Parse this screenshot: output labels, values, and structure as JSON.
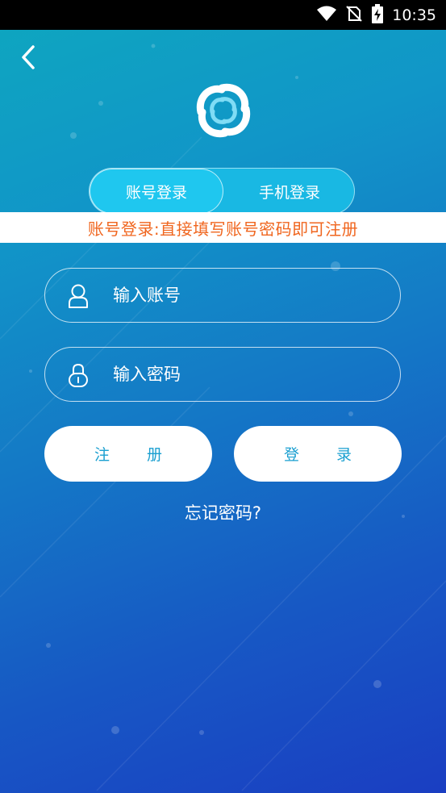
{
  "status_bar": {
    "time": "10:35",
    "icons": [
      "wifi-icon",
      "no-sim-icon",
      "battery-charging-icon"
    ]
  },
  "nav": {
    "back_icon": "chevron-left-icon"
  },
  "tabs": [
    {
      "label": "账号登录",
      "active": true
    },
    {
      "label": "手机登录",
      "active": false
    }
  ],
  "notice": "账号登录:直接填写账号密码即可注册",
  "form": {
    "account": {
      "placeholder": "输入账号",
      "value": "",
      "icon": "user-icon"
    },
    "password": {
      "placeholder": "输入密码",
      "value": "",
      "icon": "lock-icon"
    }
  },
  "buttons": {
    "register": "注 册",
    "login": "登 录"
  },
  "forgot_password": "忘记密码?",
  "colors": {
    "accent": "#1a9fd0",
    "notice": "#f0661f",
    "bg_top": "#0ea7bf",
    "bg_bottom": "#1a3ec2"
  }
}
